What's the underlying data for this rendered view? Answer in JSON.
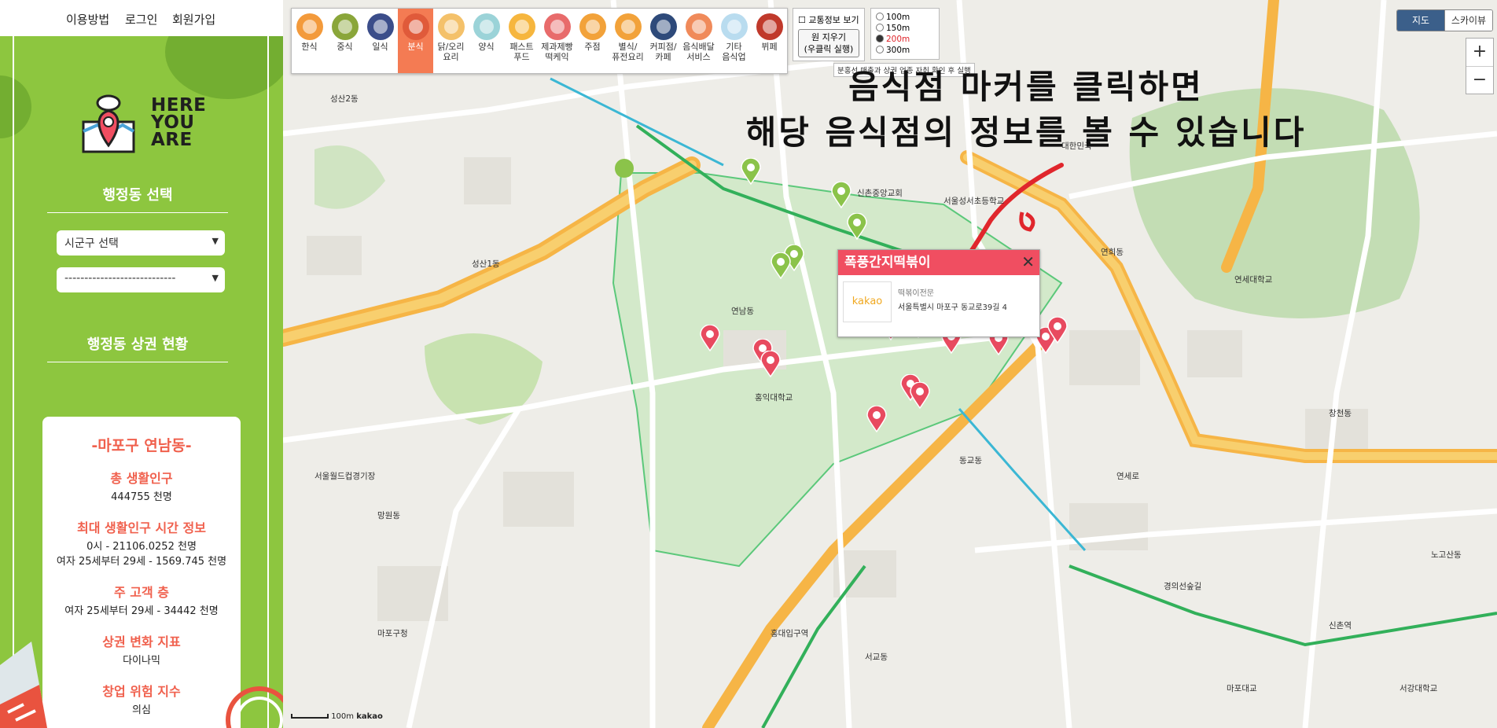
{
  "nav": {
    "guide": "이용방법",
    "login": "로그인",
    "signup": "회원가입"
  },
  "logo": {
    "line1": "HERE",
    "line2": "YOU",
    "line3": "ARE"
  },
  "sidebar": {
    "dong_select_title": "행정동 선택",
    "district_select": "시군구 선택",
    "dong_select": "----------------------------",
    "status_title": "행정동 상권 현황"
  },
  "card": {
    "area": "-마포구 연남동-",
    "total_pop_label": "총 생활인구",
    "total_pop_value": "444755 천명",
    "peak_label": "최대 생활인구 시간 정보",
    "peak_value1": "0시 - 21106.0252 천명",
    "peak_value2": "여자 25세부터 29세 - 1569.745 천명",
    "main_customer_label": "주 고객 층",
    "main_customer_value": "여자 25세부터 29세 - 34442 천명",
    "change_label": "상권 변화 지표",
    "change_value": "다이나믹",
    "risk_label": "창업 위험 지수",
    "risk_value": "의심"
  },
  "categories": [
    {
      "name": "한식",
      "color": "#f39a3b",
      "icon": "korean-food-icon"
    },
    {
      "name": "중식",
      "color": "#8aa63a",
      "icon": "chinese-food-icon"
    },
    {
      "name": "일식",
      "color": "#3b4d8a",
      "icon": "japanese-food-icon"
    },
    {
      "name": "분식",
      "color": "#e05a3a",
      "icon": "snack-food-icon",
      "active": true
    },
    {
      "name": "닭/오리\n요리",
      "color": "#f4c16a",
      "icon": "chicken-icon"
    },
    {
      "name": "양식",
      "color": "#9bd3d8",
      "icon": "western-food-icon"
    },
    {
      "name": "패스트\n푸드",
      "color": "#f6b63e",
      "icon": "fast-food-icon"
    },
    {
      "name": "제과제빵\n떡케익",
      "color": "#e86b6b",
      "icon": "bakery-icon"
    },
    {
      "name": "주점",
      "color": "#f2a23a",
      "icon": "pub-icon"
    },
    {
      "name": "별식/\n퓨전요리",
      "color": "#f2a23a",
      "icon": "fusion-icon"
    },
    {
      "name": "커피점/\n카페",
      "color": "#2e4a7a",
      "icon": "cafe-icon"
    },
    {
      "name": "음식배달\n서비스",
      "color": "#f08a5a",
      "icon": "delivery-icon"
    },
    {
      "name": "기타\n음식업",
      "color": "#b9dcef",
      "icon": "other-food-icon"
    },
    {
      "name": "뷔페",
      "color": "#c0392b",
      "icon": "buffet-icon"
    }
  ],
  "controls": {
    "traffic": "교통정보 보기",
    "clear_btn": "원 지우기\n(우클릭 실행)",
    "radius": [
      "100m",
      "150m",
      "200m",
      "300m"
    ],
    "radius_selected": "200m",
    "hint": "분홍선 매출과 상권 업종 자취 확인 후 실행",
    "map": "지도",
    "skyview": "스카이뷰",
    "zoom_in": "+",
    "zoom_out": "−",
    "scale": "100m",
    "brand": "kakao"
  },
  "annotation": {
    "line1": "음식점 마커를 클릭하면",
    "line2": "해당 음식점의 정보를 볼 수 있습니다"
  },
  "popup": {
    "title": "폭풍간지떡볶이",
    "logo": "kakao",
    "category": "떡볶이전문",
    "address": "서울특별시 마포구 동교로39길 4"
  },
  "poi_labels": [
    "연세로",
    "신촌역",
    "홍대입구역",
    "성산1동",
    "서울월드컵경기장",
    "경의선숲길",
    "연남동",
    "동교동",
    "서교동",
    "망원동",
    "성산2동",
    "연희동",
    "신촌중앙교회",
    "홍익대학교",
    "마포구청",
    "서울성서초등학교",
    "대한민국",
    "연세대학교",
    "창천동",
    "노고산동",
    "서강대학교",
    "마포대교"
  ],
  "colors": {
    "accent": "#f47b53",
    "sidebar_green": "#8dc63f",
    "popup_red": "#f04e61",
    "marker_red": "#e84a5f",
    "marker_green": "#8bc34a"
  }
}
